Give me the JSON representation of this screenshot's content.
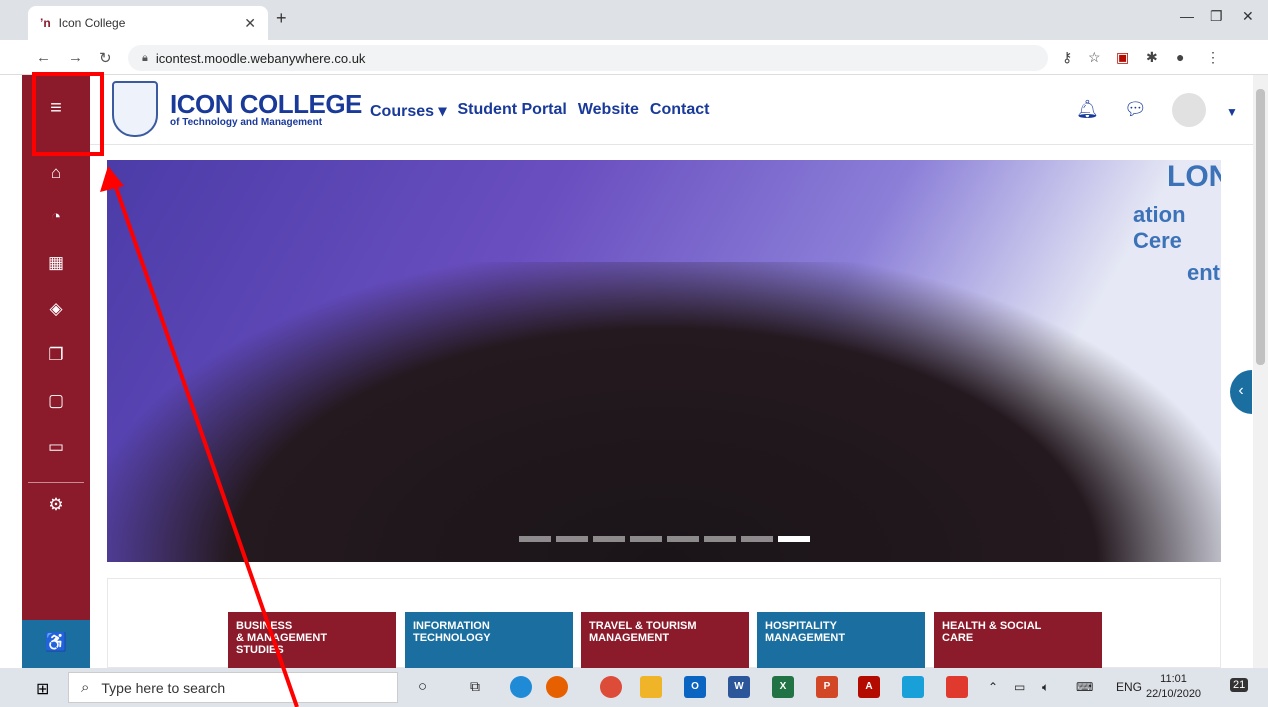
{
  "browser": {
    "tab_title": "Icon College",
    "tab_favicon": "ʼn",
    "url": "icontest.moodle.webanywhere.co.uk"
  },
  "header": {
    "logo_title": "ICON COLLEGE",
    "logo_subtitle": "of Technology and Management",
    "menu": [
      {
        "label": "Courses ▾"
      },
      {
        "label": "Student Portal"
      },
      {
        "label": "Website"
      },
      {
        "label": "Contact"
      }
    ]
  },
  "sidebar": {
    "icons": [
      "menu-icon",
      "home-icon",
      "dashboard-icon",
      "calendar-icon",
      "layers-icon",
      "files-icon",
      "clipboard-icon",
      "folder-icon",
      "gear-icon",
      "accessibility-icon"
    ]
  },
  "hero": {
    "banner_fragments": [
      "ation Cere",
      "entre",
      "LONDON"
    ],
    "slide_count": 8,
    "active_slide": 8
  },
  "tiles": [
    {
      "label": "BUSINESS\n& MANAGEMENT\nSTUDIES"
    },
    {
      "label": "INFORMATION\nTECHNOLOGY"
    },
    {
      "label": "TRAVEL & TOURISM\nMANAGEMENT"
    },
    {
      "label": "HOSPITALITY\nMANAGEMENT"
    },
    {
      "label": "HEALTH & SOCIAL\nCARE"
    }
  ],
  "taskbar": {
    "search_placeholder": "Type here to search",
    "lang": "ENG",
    "time": "11:01",
    "date": "22/10/2020",
    "notifications": "21"
  },
  "colors": {
    "brand_maroon": "#8b1a2b",
    "brand_blue": "#1a3a9a",
    "tile_blue": "#1a6fa0",
    "annotation_red": "#ff0000"
  }
}
